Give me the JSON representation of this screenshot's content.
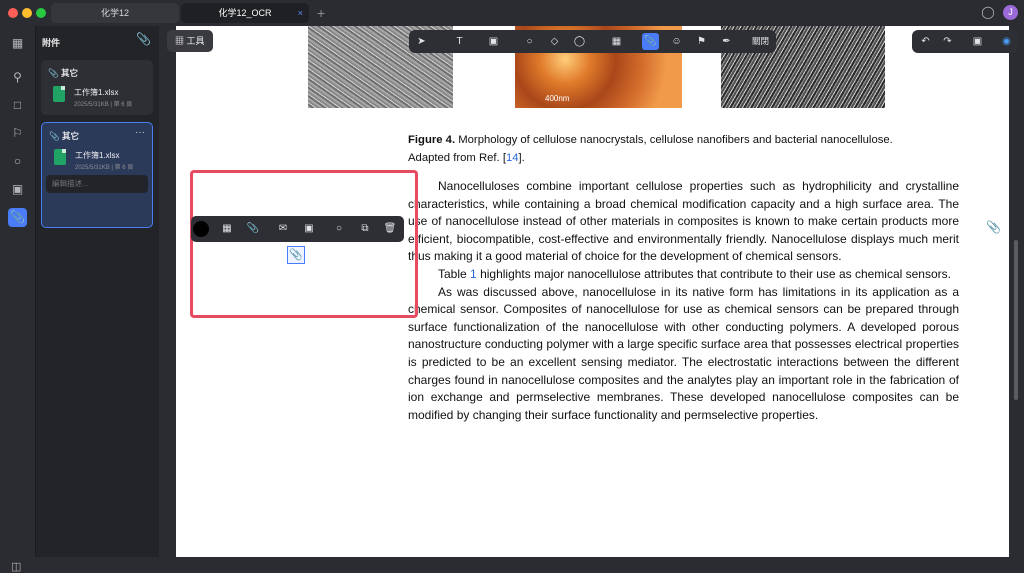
{
  "tabs": [
    {
      "label": "化学12"
    },
    {
      "label": "化学12_OCR"
    }
  ],
  "tab_close": "×",
  "new_tab": "+",
  "avatar": "J",
  "panel": {
    "title": "附件"
  },
  "attachments": [
    {
      "tag": "其它",
      "file": "工作簿1.xlsx",
      "meta": "2025/5/31KB | 第 6 頁"
    },
    {
      "tag": "其它",
      "file": "工作簿1.xlsx",
      "meta": "2025/5/31KB | 第 6 頁",
      "desc_placeholder": "編輯描述..."
    }
  ],
  "tools_button": "工具",
  "toolbar_read": "關閉",
  "figure": {
    "label": "Figure 4.",
    "caption": "Morphology of cellulose nanocrystals, cellulose nanofibers and bacterial nanocellulose.",
    "adapted": "Adapted from Ref. [",
    "ref": "14",
    "end": "]."
  },
  "scale_label": "400nm",
  "paragraphs": [
    "Nanocelluloses combine important cellulose properties such as hydrophilicity and crystalline characteristics, while containing a broad chemical modification capacity and a high surface area. The use of nanocellulose instead of other materials in composites is known to make certain products more efficient, biocompatible, cost-effective and environmentally friendly. Nanocellulose displays much merit thus making it a good material of choice for the development of chemical sensors.",
    "highlights major nanocellulose attributes that contribute to their use as chemical sensors.",
    "As was discussed above, nanocellulose in its native form has limitations in its application as a chemical sensor. Composites of nanocellulose for use as chemical sensors can be prepared through surface functionalization of the nanocellulose with other conducting polymers. A developed porous nanostructure conducting polymer with a large specific surface area that possesses electrical properties is predicted to be an excellent sensing mediator. The electrostatic interactions between the different charges found in nanocellulose composites and the analytes play an important role in the fabrication of ion exchange and permselective membranes. These developed nanocellulose composites can be modified by changing their surface functionality and permselective properties."
  ],
  "table_word": "Table",
  "table_ref": "1",
  "colors": {
    "accent": "#4a7cf7",
    "highlight_box": "#e84a5f"
  }
}
